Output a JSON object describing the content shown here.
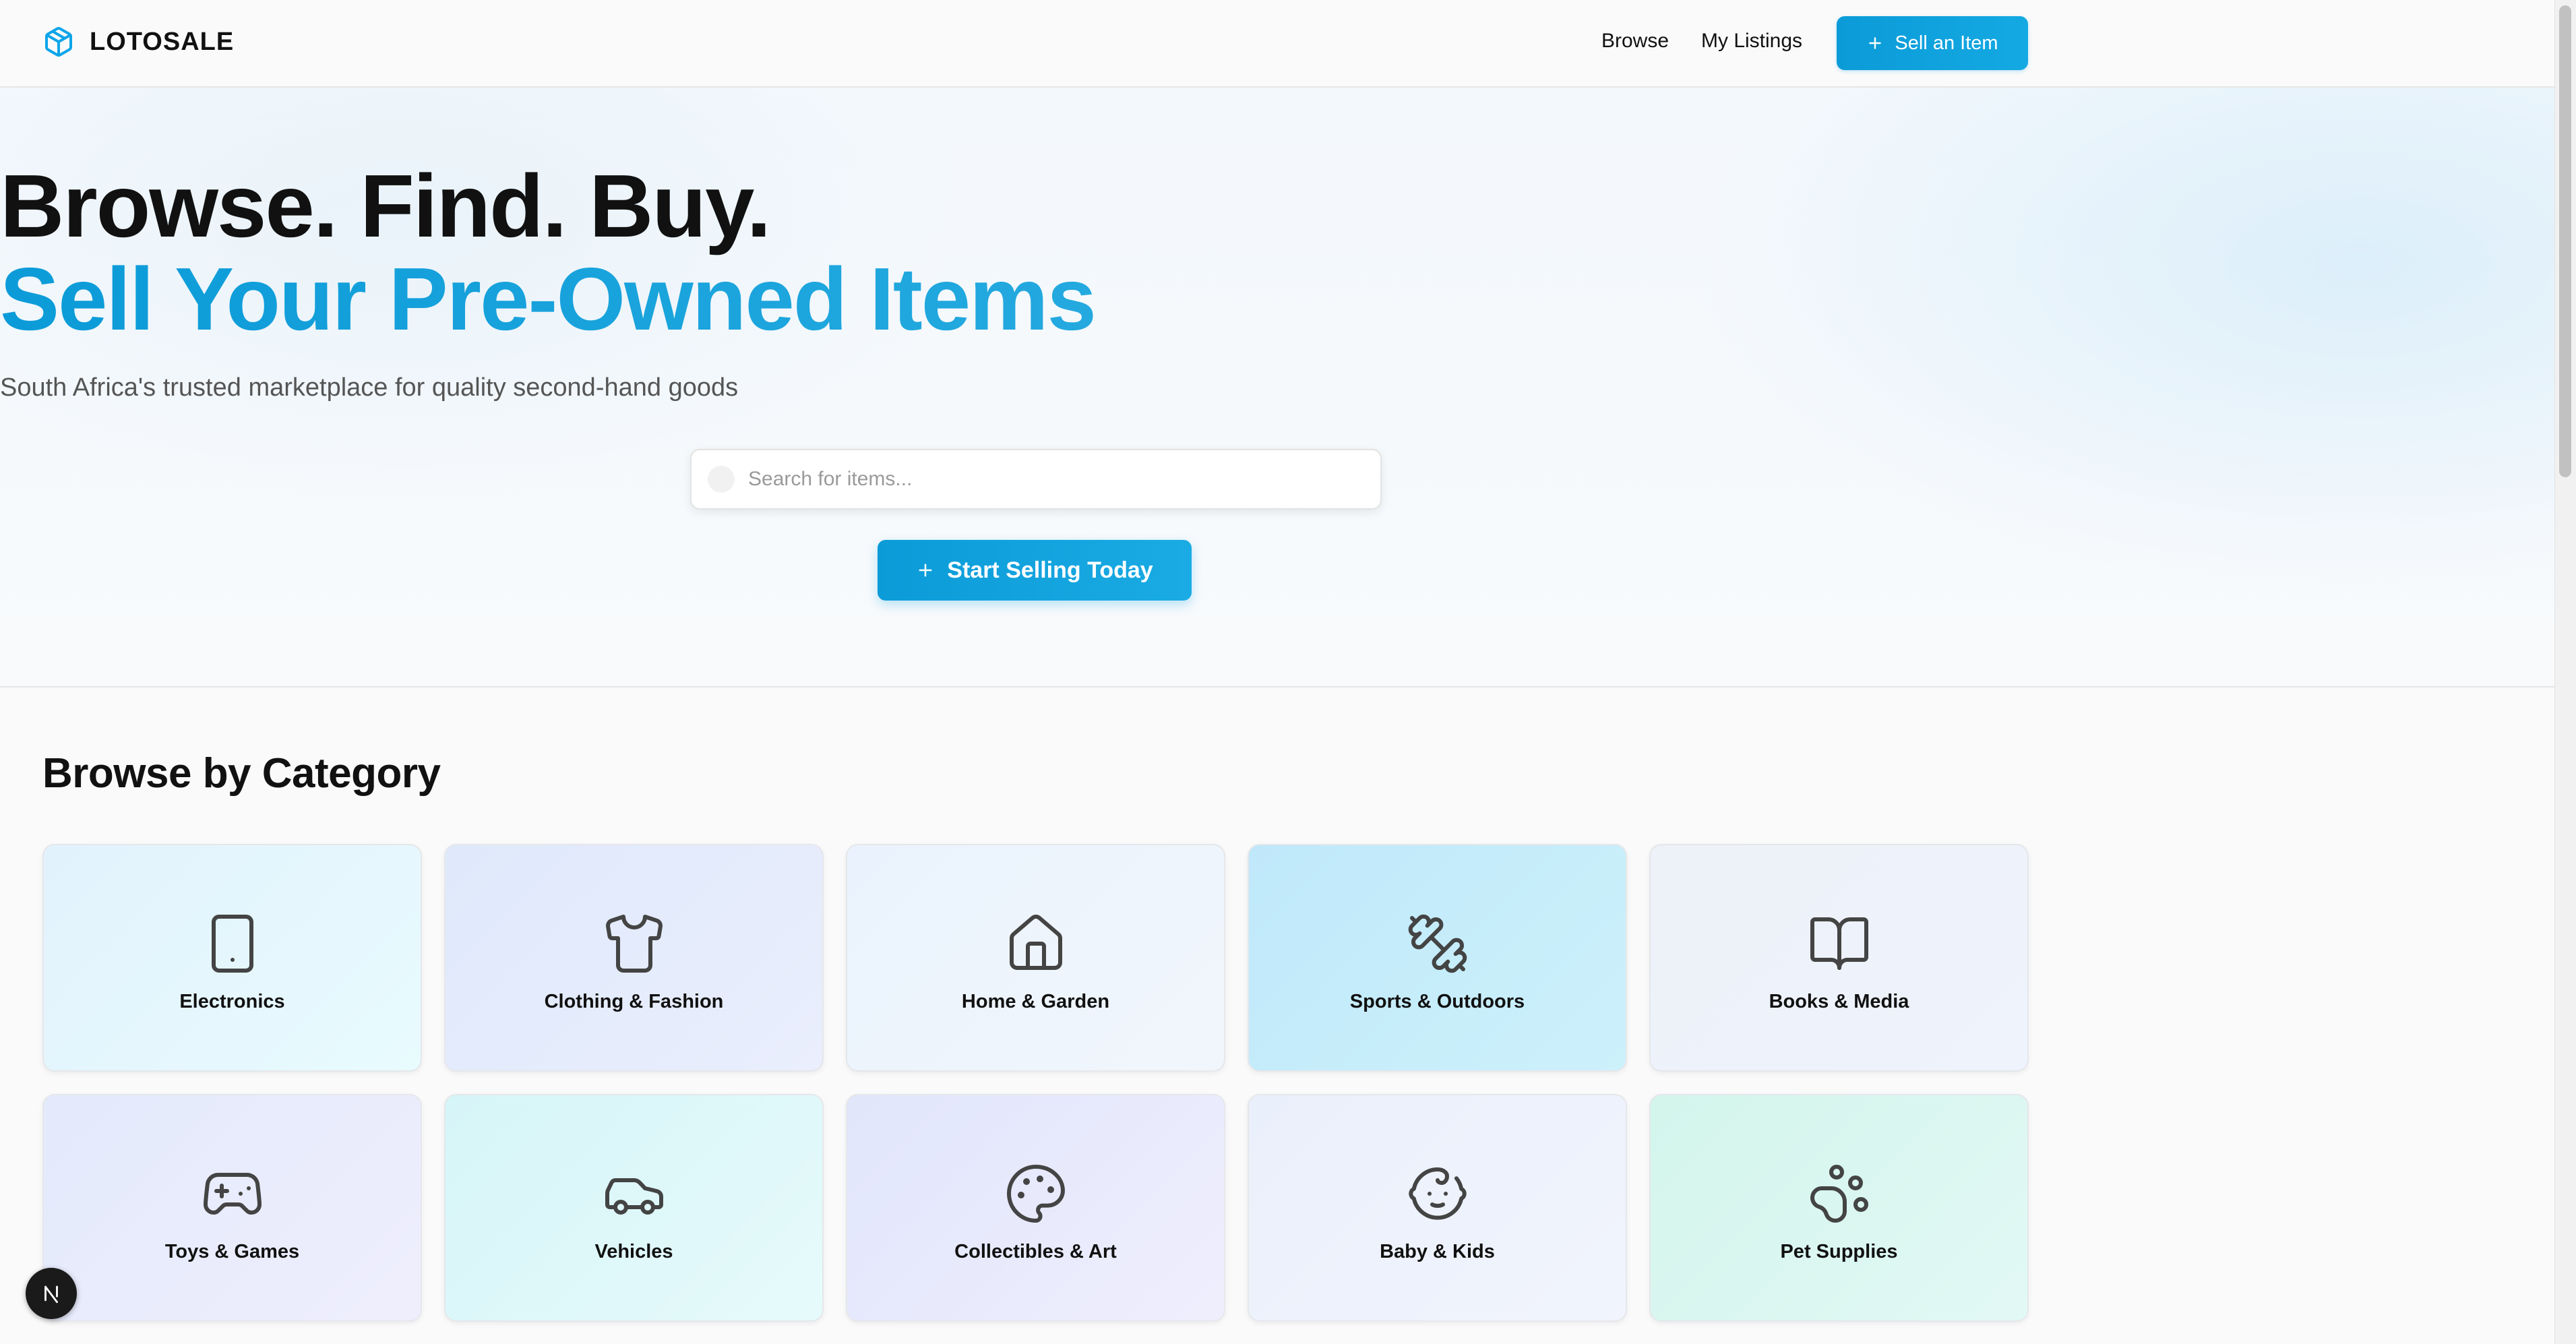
{
  "header": {
    "brand": "LOTOSALE",
    "nav": {
      "browse": "Browse",
      "my_listings": "My Listings"
    },
    "sell_button": "Sell an Item"
  },
  "hero": {
    "title_line1": "Browse. Find. Buy.",
    "title_line2": "Sell Your Pre-Owned Items",
    "subtitle": "South Africa's trusted marketplace for quality second-hand goods",
    "search_placeholder": "Search for items...",
    "cta": "Start Selling Today"
  },
  "categories": {
    "title": "Browse by Category",
    "items": [
      {
        "label": "Electronics",
        "icon": "tablet-icon"
      },
      {
        "label": "Clothing & Fashion",
        "icon": "shirt-icon"
      },
      {
        "label": "Home & Garden",
        "icon": "house-icon"
      },
      {
        "label": "Sports & Outdoors",
        "icon": "dumbbell-icon"
      },
      {
        "label": "Books & Media",
        "icon": "book-open-icon"
      },
      {
        "label": "Toys & Games",
        "icon": "gamepad-icon"
      },
      {
        "label": "Vehicles",
        "icon": "car-icon"
      },
      {
        "label": "Collectibles & Art",
        "icon": "palette-icon"
      },
      {
        "label": "Baby & Kids",
        "icon": "baby-icon"
      },
      {
        "label": "Pet Supplies",
        "icon": "paw-icon"
      }
    ]
  },
  "colors": {
    "accent": "#0ea5e9",
    "gradient_text": "#1aa3dc",
    "card_backgrounds": [
      "#e6f4fd",
      "#e3ecfb",
      "#edf4fc",
      "#c9ecfa",
      "#eef2f8",
      "#e9ecfb",
      "#dcf6f7",
      "#e6e9fb",
      "#edf2fb",
      "#d9f6ef"
    ]
  }
}
